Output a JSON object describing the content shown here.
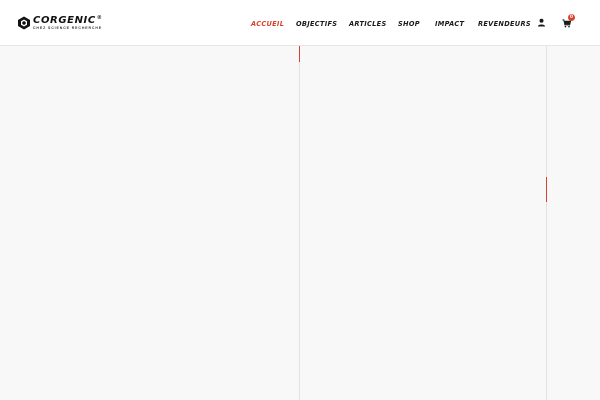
{
  "brand": {
    "name": "CORGENIC",
    "registered": "®",
    "tagline": "CHEZ SCIENCE RECHERCHE"
  },
  "nav": {
    "items": [
      {
        "label": "ACCUEIL",
        "active": true
      },
      {
        "label": "OBJECTIFS",
        "active": false
      },
      {
        "label": "ARTICLES",
        "active": false
      },
      {
        "label": "SHOP",
        "active": false
      },
      {
        "label": "IMPACT",
        "active": false
      },
      {
        "label": "REVENDEURS",
        "active": false
      }
    ]
  },
  "cart": {
    "count": "0"
  },
  "icons": {
    "logo": "hexagon-logo-icon",
    "user": "user-icon",
    "cart": "cart-icon"
  },
  "colors": {
    "accent": "#d9412e",
    "text": "#1a1a1a",
    "header_bg": "#ffffff",
    "page_bg": "#f8f8f8"
  }
}
